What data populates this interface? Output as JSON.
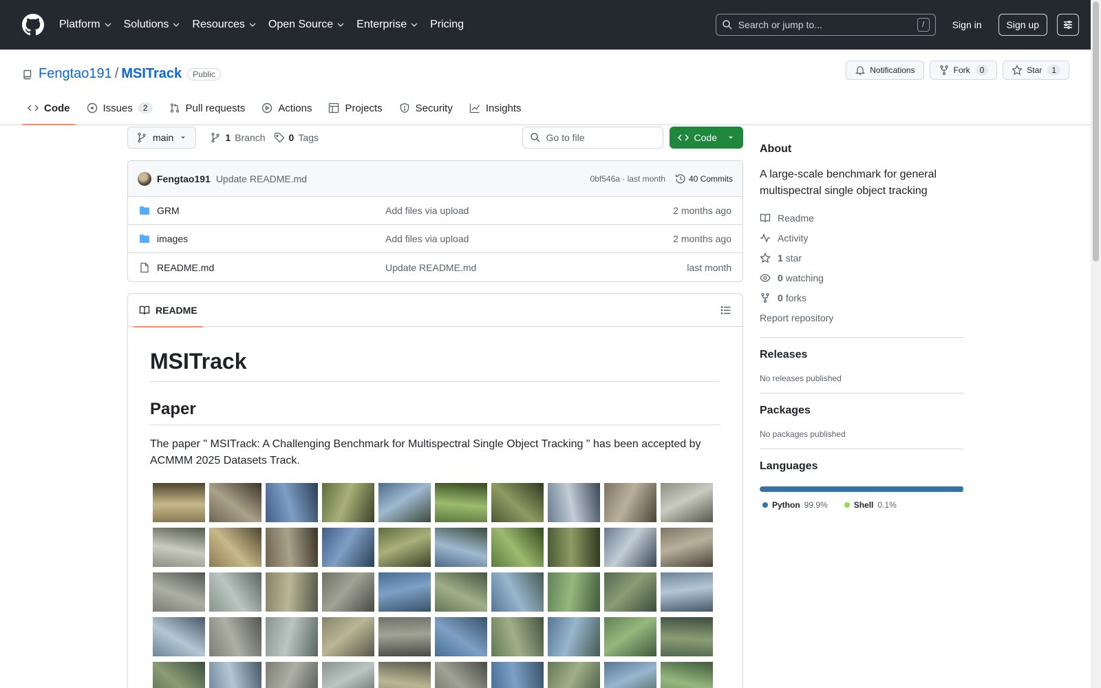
{
  "header": {
    "nav": [
      "Platform",
      "Solutions",
      "Resources",
      "Open Source",
      "Enterprise",
      "Pricing"
    ],
    "search_placeholder": "Search or jump to...",
    "search_key": "/",
    "signin": "Sign in",
    "signup": "Sign up"
  },
  "repo": {
    "owner": "Fengtao191",
    "separator": "/",
    "name": "MSITrack",
    "visibility": "Public",
    "notifications": "Notifications",
    "fork_label": "Fork",
    "fork_count": "0",
    "star_label": "Star",
    "star_count": "1"
  },
  "tabs": [
    {
      "label": "Code",
      "icon": "code-icon"
    },
    {
      "label": "Issues",
      "count": "2",
      "icon": "issue-icon"
    },
    {
      "label": "Pull requests",
      "icon": "pull-request-icon"
    },
    {
      "label": "Actions",
      "icon": "play-icon"
    },
    {
      "label": "Projects",
      "icon": "table-icon"
    },
    {
      "label": "Security",
      "icon": "shield-icon"
    },
    {
      "label": "Insights",
      "icon": "graph-icon"
    }
  ],
  "toolbar": {
    "branch": "main",
    "branch_count": "1",
    "branch_label": "Branch",
    "tag_count": "0",
    "tag_label": "Tags",
    "goto_placeholder": "Go to file",
    "code_button": "Code"
  },
  "commit": {
    "author": "Fengtao191",
    "message": "Update README.md",
    "hash_time": "0bf546a · last month",
    "commits_count": "40 Commits"
  },
  "files": [
    {
      "name": "GRM",
      "type": "folder",
      "commit": "Add files via upload",
      "time": "2 months ago"
    },
    {
      "name": "images",
      "type": "folder",
      "commit": "Add files via upload",
      "time": "2 months ago"
    },
    {
      "name": "README.md",
      "type": "file",
      "commit": "Update README.md",
      "time": "last month"
    }
  ],
  "readme": {
    "tab": "README",
    "h1": "MSITrack",
    "h2": "Paper",
    "paragraph": "The paper \" MSITrack: A Challenging Benchmark for Multispectral Single Object Tracking \" has been accepted by ACMMM 2025 Datasets Track."
  },
  "about": {
    "title": "About",
    "description": "A large-scale benchmark for general multispectral single object tracking",
    "readme": "Readme",
    "activity": "Activity",
    "stars_count": "1",
    "stars_label": "star",
    "watching_count": "0",
    "watching_label": "watching",
    "forks_count": "0",
    "forks_label": "forks",
    "report": "Report repository"
  },
  "releases": {
    "title": "Releases",
    "note": "No releases published"
  },
  "packages": {
    "title": "Packages",
    "note": "No packages published"
  },
  "languages": {
    "title": "Languages",
    "items": [
      {
        "name": "Python",
        "pct": "99.9%",
        "share": 0.999,
        "color": "#3572A5"
      },
      {
        "name": "Shell",
        "pct": "0.1%",
        "share": 0.001,
        "color": "#89e051"
      }
    ]
  }
}
